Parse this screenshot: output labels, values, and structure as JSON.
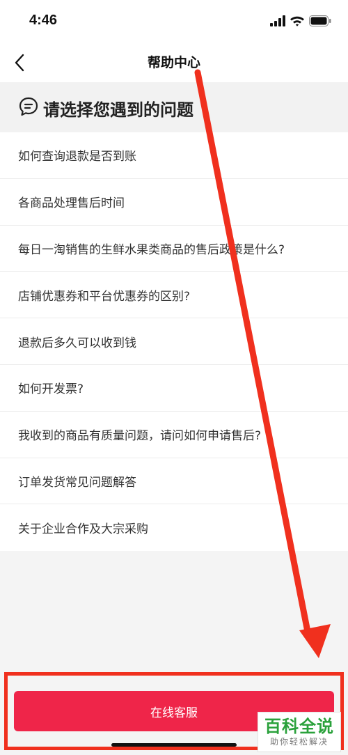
{
  "status_bar": {
    "time": "4:46",
    "icons": [
      "cellular-signal-icon",
      "wifi-icon",
      "battery-icon"
    ]
  },
  "nav": {
    "back_icon": "chevron-left-icon",
    "title": "帮助中心"
  },
  "section": {
    "icon": "chat-bubble-icon",
    "title": "请选择您遇到的问题"
  },
  "faq": {
    "items": [
      {
        "label": "如何查询退款是否到账"
      },
      {
        "label": "各商品处理售后时间"
      },
      {
        "label": "每日一淘销售的生鲜水果类商品的售后政策是什么?"
      },
      {
        "label": "店铺优惠券和平台优惠券的区别?"
      },
      {
        "label": "退款后多久可以收到钱"
      },
      {
        "label": "如何开发票?"
      },
      {
        "label": "我收到的商品有质量问题，请问如何申请售后?"
      },
      {
        "label": "订单发货常见问题解答"
      },
      {
        "label": "关于企业合作及大宗采购"
      }
    ]
  },
  "bottom": {
    "service_button_label": "在线客服"
  },
  "watermark": {
    "title": "百科全说",
    "subtitle": "助你轻松解决"
  },
  "colors": {
    "accent": "#ef2549",
    "annotation": "#f0301e",
    "watermark": "#2aa13b"
  }
}
